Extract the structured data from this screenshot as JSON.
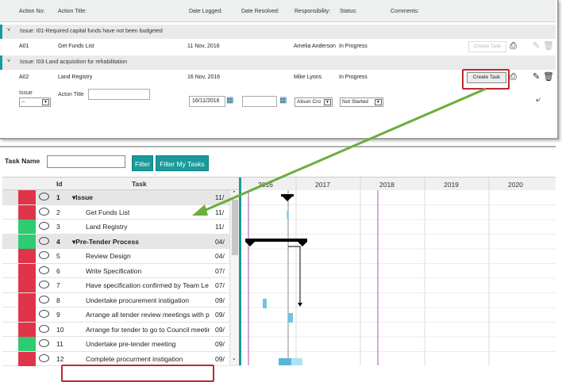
{
  "top": {
    "headers": [
      "Action No:",
      "Action Title:",
      "Date Logged:",
      "Date Resolved:",
      "Responsibility:",
      "Status:",
      "Comments:"
    ],
    "issue1": {
      "chev": "˅",
      "label": "Issue: I01-Required capital funds have not been budgeted"
    },
    "action1": {
      "no": "A01",
      "title": "Get Funds List",
      "logged": "11 Nov, 2016",
      "resp": "Amelia Anderson",
      "status": "In Progress",
      "btn": "Create Task"
    },
    "issue2": {
      "chev": "˅",
      "label": "Issue: I03-Land acquisition for rehabilitation"
    },
    "action2": {
      "no": "A02",
      "title": "Land Registry",
      "logged": "16 Nov, 2016",
      "resp": "Mike Lyons",
      "status": "In Progress",
      "btn": "Create Task"
    },
    "form": {
      "issue_label": "Issue",
      "issue_value": "--",
      "title_label": "Acton Title",
      "date_value": "16/11/2016",
      "resp_value": "Alison Cro",
      "status_value": "Not Started"
    }
  },
  "gantt": {
    "task_name_label": "Task Name",
    "filter_btn": "Filter",
    "filter_my_btn": "Filter My Tasks",
    "col_id": "Id",
    "col_task": "Task",
    "years": [
      "2016",
      "2017",
      "2018",
      "2019",
      "2020"
    ],
    "rows": [
      {
        "id": "1",
        "task": "Issue",
        "date": "11/",
        "group": true,
        "color": "#e0344a"
      },
      {
        "id": "2",
        "task": "Get Funds List",
        "date": "11/",
        "group": false,
        "color": "#e0344a"
      },
      {
        "id": "3",
        "task": "Land Registry",
        "date": "11/",
        "group": false,
        "color": "#2ecc71"
      },
      {
        "id": "4",
        "task": "Pre-Tender Process",
        "date": "04/",
        "group": true,
        "color": "#2ecc71"
      },
      {
        "id": "5",
        "task": "Review Design",
        "date": "04/",
        "group": false,
        "color": "#e0344a"
      },
      {
        "id": "6",
        "task": "Write Specification",
        "date": "07/",
        "group": false,
        "color": "#e0344a"
      },
      {
        "id": "7",
        "task": "Have specification confirmed by Team Le",
        "date": "07/",
        "group": false,
        "color": "#e0344a"
      },
      {
        "id": "8",
        "task": "Undertake procurement instigation",
        "date": "09/",
        "group": false,
        "color": "#e0344a"
      },
      {
        "id": "9",
        "task": "Arrange all tender review meetings with p",
        "date": "09/",
        "group": false,
        "color": "#e0344a"
      },
      {
        "id": "10",
        "task": "Arrange for tender to go to Council meetir",
        "date": "09/",
        "group": false,
        "color": "#e0344a"
      },
      {
        "id": "11",
        "task": "Undertake pre-tender meeting",
        "date": "09/",
        "group": false,
        "color": "#2ecc71"
      },
      {
        "id": "12",
        "task": "Complete procurment instigation",
        "date": "09/",
        "group": false,
        "color": "#e0344a"
      }
    ]
  }
}
